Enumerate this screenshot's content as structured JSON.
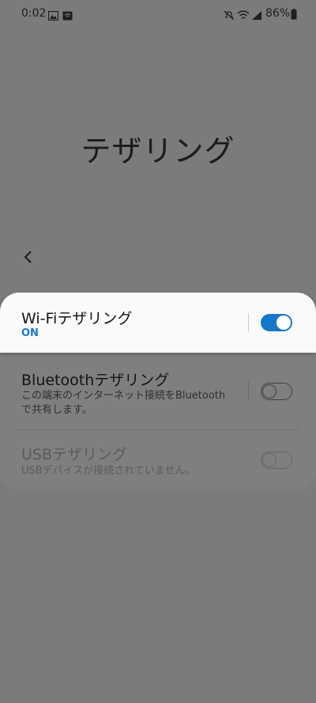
{
  "status_bar": {
    "time": "0:02",
    "battery": "86%",
    "icons": [
      "image-icon",
      "data-saver-icon",
      "mute-icon",
      "wifi-icon",
      "signal-icon",
      "battery-icon"
    ]
  },
  "page": {
    "title": "テザリング"
  },
  "tethering": {
    "wifi": {
      "title": "Wi-Fiテザリング",
      "status": "ON",
      "enabled": true
    },
    "bluetooth": {
      "title": "Bluetoothテザリング",
      "description": "この端末のインターネット接続をBluetoothで共有します。",
      "enabled": false
    },
    "usb": {
      "title": "USBテザリング",
      "description": "USBデバイスが接続されていません。",
      "enabled": false
    }
  },
  "colors": {
    "accent": "#1777c9",
    "dim_background": "#7b7b7b",
    "highlight_row": "#fafafa"
  }
}
